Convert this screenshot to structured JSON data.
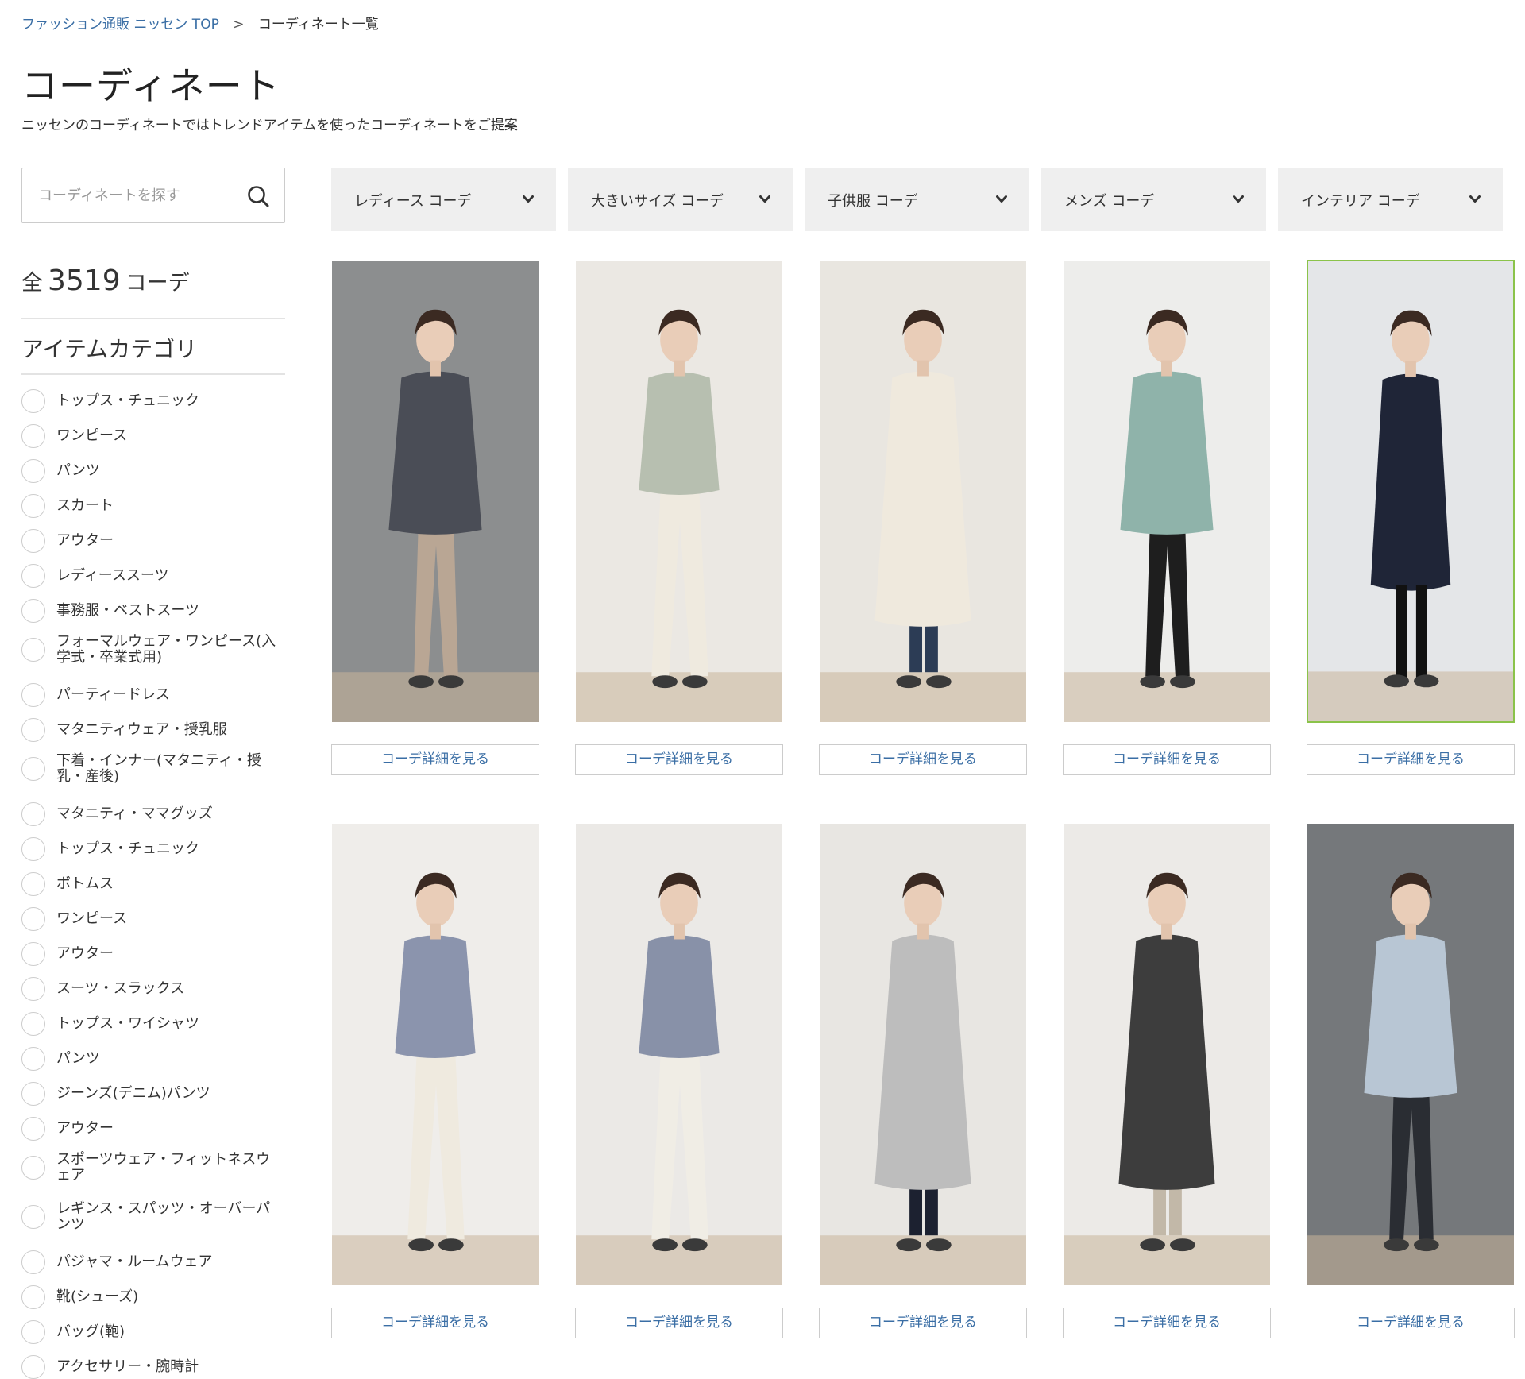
{
  "breadcrumb": {
    "home": "ファッション通販 ニッセン TOP",
    "separator": ">",
    "current": "コーディネート一覧"
  },
  "page": {
    "title": "コーディネート",
    "description": "ニッセンのコーディネートではトレンドアイテムを使ったコーディネートをご提案"
  },
  "search": {
    "placeholder": "コーディネートを探す",
    "icon": "search-icon"
  },
  "count": {
    "prefix": "全",
    "value": "3519",
    "suffix": "コーデ"
  },
  "category": {
    "heading": "アイテムカテゴリ",
    "items": [
      "トップス・チュニック",
      "ワンピース",
      "パンツ",
      "スカート",
      "アウター",
      "レディーススーツ",
      "事務服・ベストスーツ",
      "フォーマルウェア・ワンピース(入学式・卒業式用)",
      "パーティードレス",
      "マタニティウェア・授乳服",
      "下着・インナー(マタニティ・授乳・産後)",
      "マタニティ・ママグッズ",
      "トップス・チュニック",
      "ボトムス",
      "ワンピース",
      "アウター",
      "スーツ・スラックス",
      "トップス・ワイシャツ",
      "パンツ",
      "ジーンズ(デニム)パンツ",
      "アウター",
      "スポーツウェア・フィットネスウェア",
      "レギンス・スパッツ・オーバーパンツ",
      "パジャマ・ルームウェア",
      "靴(シューズ)",
      "バッグ(鞄)",
      "アクセサリー・腕時計"
    ]
  },
  "filters": [
    {
      "label": "レディース コーデ",
      "icon": "chevron-down-icon"
    },
    {
      "label": "大きいサイズ コーデ",
      "icon": "chevron-down-icon"
    },
    {
      "label": "子供服 コーデ",
      "icon": "chevron-down-icon"
    },
    {
      "label": "メンズ コーデ",
      "icon": "chevron-down-icon"
    },
    {
      "label": "インテリア コーデ",
      "icon": "chevron-down-icon"
    }
  ],
  "coordinates": {
    "button_label": "コーデ詳細を見る",
    "selected_color": "#8bc34a",
    "items": [
      {
        "bg": "#8c8e8f",
        "top": "#4a4d56",
        "bottom": "#b9a694",
        "length": "tunic"
      },
      {
        "bg": "#ebe8e3",
        "top": "#b7bfb0",
        "bottom": "#efeadf",
        "length": "blouse"
      },
      {
        "bg": "#e9e6e0",
        "top": "#efe9dd",
        "bottom": "#2c3c55",
        "length": "coat"
      },
      {
        "bg": "#ededeb",
        "top": "#8fb3aa",
        "bottom": "#1e1e1e",
        "length": "tunic"
      },
      {
        "bg": "#e4e6e8",
        "top": "#1f2537",
        "bottom": "#111111",
        "length": "dress",
        "selected": true
      },
      {
        "bg": "#efedea",
        "top": "#8b94ad",
        "bottom": "#efeadf",
        "length": "blouse"
      },
      {
        "bg": "#ebe9e6",
        "top": "#8891a8",
        "bottom": "#f0ede5",
        "length": "blouse"
      },
      {
        "bg": "#e8e6e2",
        "top": "#bdbdbd",
        "bottom": "#1c2130",
        "length": "coat"
      },
      {
        "bg": "#eceae7",
        "top": "#3d3d3d",
        "bottom": "#c2b8a8",
        "length": "coat"
      },
      {
        "bg": "#75787b",
        "top": "#b8c6d4",
        "bottom": "#2a2d33",
        "length": "tunic"
      }
    ]
  }
}
